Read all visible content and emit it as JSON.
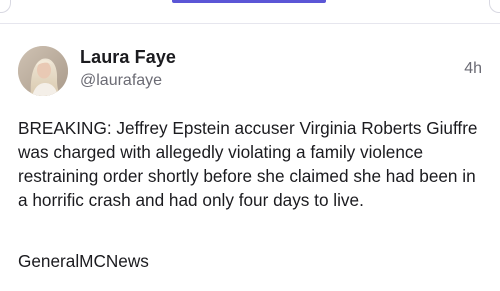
{
  "post": {
    "author_name": "Laura Faye",
    "author_handle": "@laurafaye",
    "timestamp": "4h",
    "body": "BREAKING: Jeffrey Epstein accuser Virginia Roberts Giuffre was charged with allegedly violating a family violence restraining order shortly before she claimed she had been in a horrific crash and had only four days to live.",
    "source": "GeneralMCNews"
  },
  "colors": {
    "accent": "#5b56d6",
    "secondary_text": "#6b6b74",
    "primary_text": "#1b1b1f"
  },
  "icons": {
    "avatar": "profile-photo"
  }
}
